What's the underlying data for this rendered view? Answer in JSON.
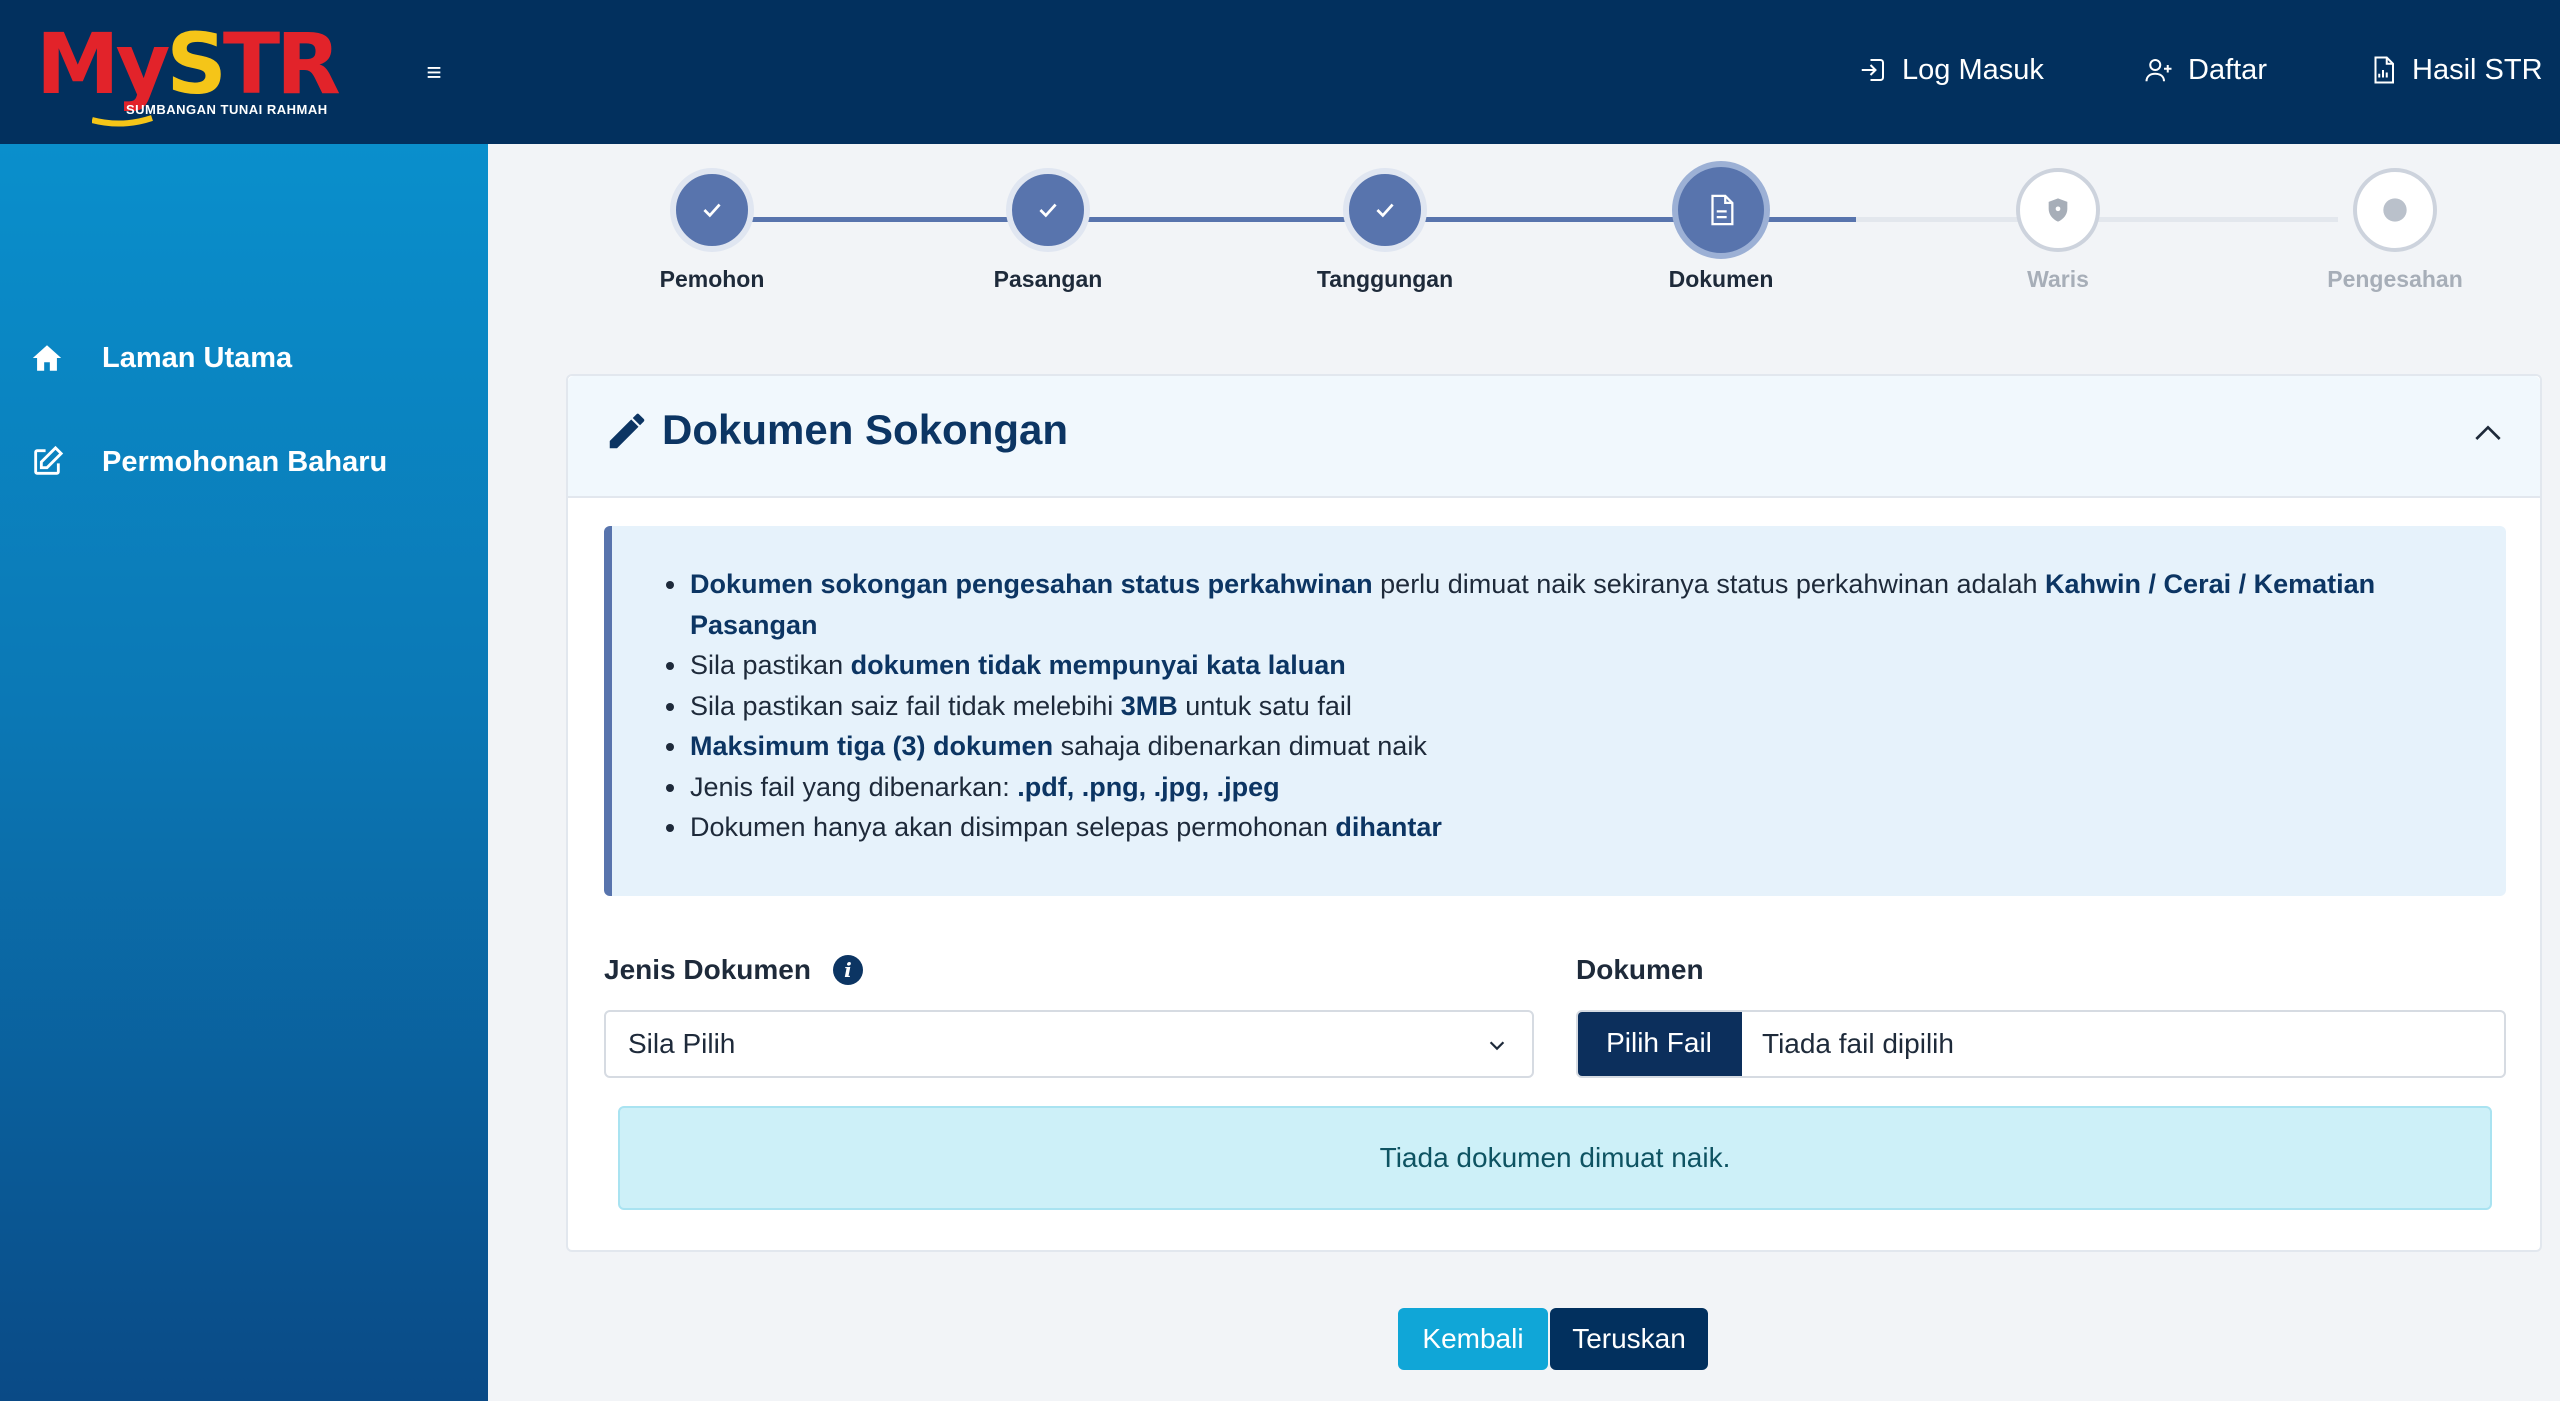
{
  "header": {
    "logo": {
      "text_my": "My",
      "text_s": "S",
      "text_tr": "TR",
      "subtitle": "SUMBANGAN TUNAI RAHMAH",
      "colors": {
        "red": "#e2232a",
        "yellow": "#f5c518",
        "blue": "#1d4fa3"
      }
    },
    "menu_icon": "≡",
    "nav": [
      {
        "label": "Log Masuk",
        "icon": "login-icon"
      },
      {
        "label": "Daftar",
        "icon": "user-plus-icon"
      },
      {
        "label": "Hasil STR",
        "icon": "document-chart-icon"
      }
    ],
    "background": "#02305e"
  },
  "sidebar": {
    "items": [
      {
        "label": "Laman Utama",
        "icon": "home-icon"
      },
      {
        "label": "Permohonan Baharu",
        "icon": "edit-icon"
      }
    ]
  },
  "stepper": {
    "steps": [
      {
        "label": "Pemohon",
        "state": "done",
        "icon": "check-icon"
      },
      {
        "label": "Pasangan",
        "state": "done",
        "icon": "check-icon"
      },
      {
        "label": "Tanggungan",
        "state": "done",
        "icon": "check-icon"
      },
      {
        "label": "Dokumen",
        "state": "active",
        "icon": "document-icon"
      },
      {
        "label": "Waris",
        "state": "todo",
        "icon": "shield-icon"
      },
      {
        "label": "Pengesahan",
        "state": "todo",
        "icon": "dot-icon"
      }
    ],
    "colors": {
      "done": "#5874ad",
      "todo_line": "#e3e7ed"
    }
  },
  "card": {
    "title": "Dokumen Sokongan",
    "info": [
      {
        "b1": "Dokumen sokongan pengesahan status perkahwinan",
        "t1": " perlu dimuat naik sekiranya status perkahwinan adalah ",
        "b2": "Kahwin / Cerai / Kematian Pasangan"
      },
      {
        "t1": "Sila pastikan ",
        "b1": "dokumen tidak mempunyai kata laluan"
      },
      {
        "t1": "Sila pastikan saiz fail tidak melebihi ",
        "b1": "3MB",
        "t2": " untuk satu fail"
      },
      {
        "b1": "Maksimum tiga (3) dokumen",
        "t1": " sahaja dibenarkan dimuat naik"
      },
      {
        "t1": "Jenis fail yang dibenarkan: ",
        "b1": ".pdf, .png, .jpg, .jpeg"
      },
      {
        "t1": "Dokumen hanya akan disimpan selepas permohonan ",
        "b1": "dihantar"
      }
    ],
    "jenis_label": "Jenis Dokumen",
    "jenis_info": "i",
    "jenis_selected": "Sila Pilih",
    "dokumen_label": "Dokumen",
    "file_button": "Pilih Fail",
    "file_status": "Tiada fail dipilih",
    "empty_message": "Tiada dokumen dimuat naik."
  },
  "footer": {
    "back_label": "Kembali",
    "next_label": "Teruskan",
    "colors": {
      "back": "#10a6d7",
      "next": "#02305e"
    }
  }
}
